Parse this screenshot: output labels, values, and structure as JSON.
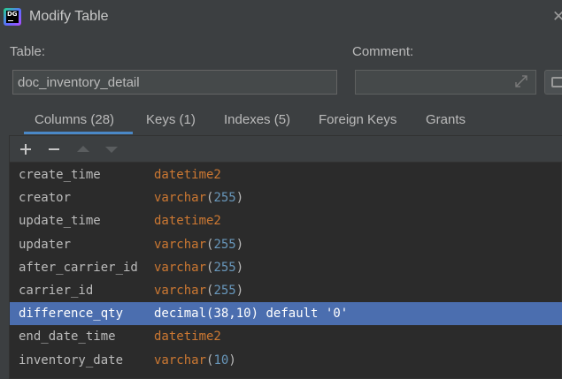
{
  "window": {
    "title": "Modify Table",
    "app_icon_text": "DG",
    "close_glyph": "✕"
  },
  "form": {
    "table_label": "Table:",
    "table_value": "doc_inventory_detail",
    "comment_label": "Comment:",
    "comment_value": ""
  },
  "tabs": [
    {
      "label": "Columns (28)",
      "active": true
    },
    {
      "label": "Keys (1)",
      "active": false
    },
    {
      "label": "Indexes (5)",
      "active": false
    },
    {
      "label": "Foreign Keys",
      "active": false
    },
    {
      "label": "Grants",
      "active": false
    }
  ],
  "toolbar": {
    "icons": [
      "plus-icon",
      "minus-icon",
      "move-up-icon",
      "move-down-icon"
    ]
  },
  "columns": [
    {
      "name": "create_time",
      "type": "datetime2",
      "args": "",
      "extra": "",
      "selected": false
    },
    {
      "name": "creator",
      "type": "varchar",
      "args": "255",
      "extra": "",
      "selected": false
    },
    {
      "name": "update_time",
      "type": "datetime2",
      "args": "",
      "extra": "",
      "selected": false
    },
    {
      "name": "updater",
      "type": "varchar",
      "args": "255",
      "extra": "",
      "selected": false
    },
    {
      "name": "after_carrier_id",
      "type": "varchar",
      "args": "255",
      "extra": "",
      "selected": false
    },
    {
      "name": "carrier_id",
      "type": "varchar",
      "args": "255",
      "extra": "",
      "selected": false
    },
    {
      "name": "difference_qty",
      "type": "decimal",
      "args": "38,10",
      "extra": " default '0'",
      "selected": true
    },
    {
      "name": "end_date_time",
      "type": "datetime2",
      "args": "",
      "extra": "",
      "selected": false
    },
    {
      "name": "inventory_date",
      "type": "varchar",
      "args": "10",
      "extra": "",
      "selected": false
    }
  ],
  "colors": {
    "background": "#3c3f41",
    "panel": "#2b2b2b",
    "keyword": "#cc7832",
    "number": "#6897bb",
    "selection": "#4b6eaf",
    "tab_accent": "#4a88c7"
  }
}
